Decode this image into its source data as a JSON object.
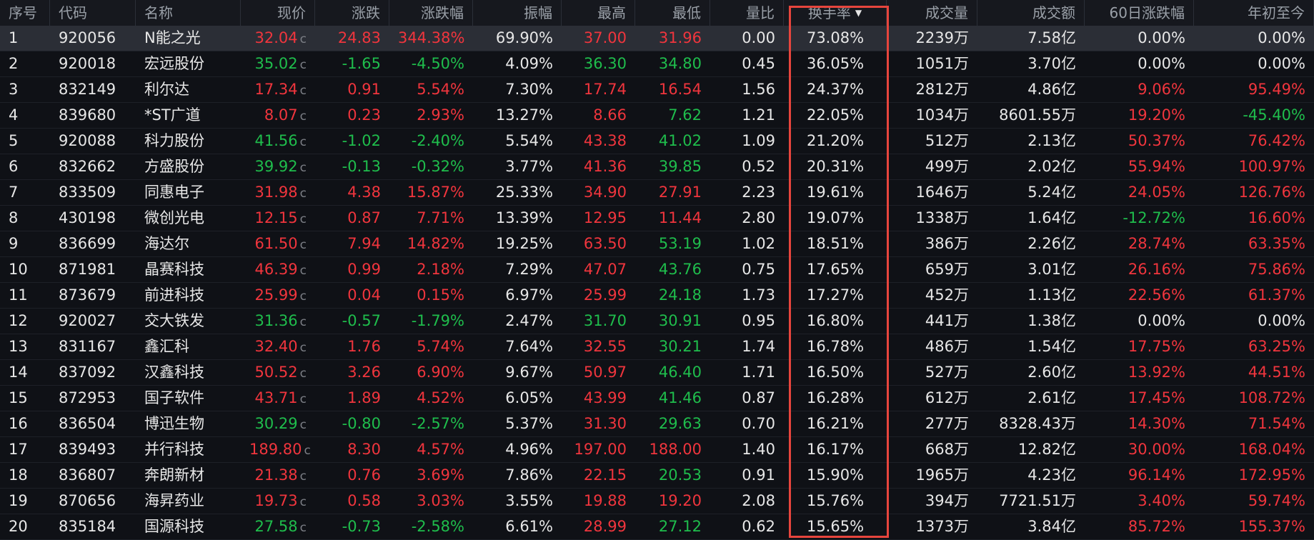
{
  "columns": [
    {
      "key": "idx",
      "label": "序号",
      "width": 70,
      "align": "left"
    },
    {
      "key": "code",
      "label": "代码",
      "width": 120,
      "align": "left"
    },
    {
      "key": "name",
      "label": "名称",
      "width": 147,
      "align": "left"
    },
    {
      "key": "price",
      "label": "现价",
      "width": 104,
      "align": "right"
    },
    {
      "key": "change",
      "label": "涨跌",
      "width": 104,
      "align": "right"
    },
    {
      "key": "pct",
      "label": "涨跌幅",
      "width": 117,
      "align": "right"
    },
    {
      "key": "amplitude",
      "label": "振幅",
      "width": 124,
      "align": "right"
    },
    {
      "key": "high",
      "label": "最高",
      "width": 103,
      "align": "right"
    },
    {
      "key": "low",
      "label": "最低",
      "width": 105,
      "align": "right"
    },
    {
      "key": "volratio",
      "label": "量比",
      "width": 103,
      "align": "right"
    },
    {
      "key": "turnover",
      "label": "换手率",
      "width": 144,
      "align": "center",
      "sorted": true
    },
    {
      "key": "volume",
      "label": "成交量",
      "width": 127,
      "align": "right"
    },
    {
      "key": "amount",
      "label": "成交额",
      "width": 150,
      "align": "right"
    },
    {
      "key": "d60",
      "label": "60日涨跌幅",
      "width": 153,
      "align": "right"
    },
    {
      "key": "ytd",
      "label": "年初至今",
      "width": 168,
      "align": "right"
    }
  ],
  "sort_arrow": "▼",
  "price_suffix": "c",
  "colors": {
    "up": "#f0353d",
    "down": "#1fbd4c",
    "flat": "#e7e7e7",
    "highlight": "#e7453d"
  },
  "rows": [
    {
      "idx": "1",
      "code": "920056",
      "name": "N能之光",
      "price": "32.04",
      "change": "24.83",
      "pct": "344.38%",
      "amplitude": "69.90%",
      "high": "37.00",
      "low": "31.96",
      "volratio": "0.00",
      "turnover": "73.08%",
      "volume": "2239万",
      "amount": "7.58亿",
      "d60": "0.00%",
      "ytd": "0.00%",
      "dir": "up",
      "highDir": "up",
      "lowDir": "up",
      "d60Dir": "flat",
      "ytdDir": "flat"
    },
    {
      "idx": "2",
      "code": "920018",
      "name": "宏远股份",
      "price": "35.02",
      "change": "-1.65",
      "pct": "-4.50%",
      "amplitude": "4.09%",
      "high": "36.30",
      "low": "34.80",
      "volratio": "0.45",
      "turnover": "36.05%",
      "volume": "1051万",
      "amount": "3.70亿",
      "d60": "0.00%",
      "ytd": "0.00%",
      "dir": "down",
      "highDir": "down",
      "lowDir": "down",
      "d60Dir": "flat",
      "ytdDir": "flat"
    },
    {
      "idx": "3",
      "code": "832149",
      "name": "利尔达",
      "price": "17.34",
      "change": "0.91",
      "pct": "5.54%",
      "amplitude": "7.30%",
      "high": "17.74",
      "low": "16.54",
      "volratio": "1.56",
      "turnover": "24.37%",
      "volume": "2812万",
      "amount": "4.86亿",
      "d60": "9.06%",
      "ytd": "95.49%",
      "dir": "up",
      "highDir": "up",
      "lowDir": "up",
      "d60Dir": "up",
      "ytdDir": "up"
    },
    {
      "idx": "4",
      "code": "839680",
      "name": "*ST广道",
      "price": "8.07",
      "change": "0.23",
      "pct": "2.93%",
      "amplitude": "13.27%",
      "high": "8.66",
      "low": "7.62",
      "volratio": "1.21",
      "turnover": "22.05%",
      "volume": "1034万",
      "amount": "8601.55万",
      "d60": "19.20%",
      "ytd": "-45.40%",
      "dir": "up",
      "highDir": "up",
      "lowDir": "down",
      "d60Dir": "up",
      "ytdDir": "down"
    },
    {
      "idx": "5",
      "code": "920088",
      "name": "科力股份",
      "price": "41.56",
      "change": "-1.02",
      "pct": "-2.40%",
      "amplitude": "5.54%",
      "high": "43.38",
      "low": "41.02",
      "volratio": "1.09",
      "turnover": "21.20%",
      "volume": "512万",
      "amount": "2.13亿",
      "d60": "50.37%",
      "ytd": "76.42%",
      "dir": "down",
      "highDir": "up",
      "lowDir": "down",
      "d60Dir": "up",
      "ytdDir": "up"
    },
    {
      "idx": "6",
      "code": "832662",
      "name": "方盛股份",
      "price": "39.92",
      "change": "-0.13",
      "pct": "-0.32%",
      "amplitude": "3.77%",
      "high": "41.36",
      "low": "39.85",
      "volratio": "0.52",
      "turnover": "20.31%",
      "volume": "499万",
      "amount": "2.02亿",
      "d60": "55.94%",
      "ytd": "100.97%",
      "dir": "down",
      "highDir": "up",
      "lowDir": "down",
      "d60Dir": "up",
      "ytdDir": "up"
    },
    {
      "idx": "7",
      "code": "833509",
      "name": "同惠电子",
      "price": "31.98",
      "change": "4.38",
      "pct": "15.87%",
      "amplitude": "25.33%",
      "high": "34.90",
      "low": "27.91",
      "volratio": "2.23",
      "turnover": "19.61%",
      "volume": "1646万",
      "amount": "5.24亿",
      "d60": "24.05%",
      "ytd": "126.76%",
      "dir": "up",
      "highDir": "up",
      "lowDir": "up",
      "d60Dir": "up",
      "ytdDir": "up"
    },
    {
      "idx": "8",
      "code": "430198",
      "name": "微创光电",
      "price": "12.15",
      "change": "0.87",
      "pct": "7.71%",
      "amplitude": "13.39%",
      "high": "12.95",
      "low": "11.44",
      "volratio": "2.80",
      "turnover": "19.07%",
      "volume": "1338万",
      "amount": "1.64亿",
      "d60": "-12.72%",
      "ytd": "16.60%",
      "dir": "up",
      "highDir": "up",
      "lowDir": "up",
      "d60Dir": "down",
      "ytdDir": "up"
    },
    {
      "idx": "9",
      "code": "836699",
      "name": "海达尔",
      "price": "61.50",
      "change": "7.94",
      "pct": "14.82%",
      "amplitude": "19.25%",
      "high": "63.50",
      "low": "53.19",
      "volratio": "1.02",
      "turnover": "18.51%",
      "volume": "386万",
      "amount": "2.26亿",
      "d60": "28.74%",
      "ytd": "63.35%",
      "dir": "up",
      "highDir": "up",
      "lowDir": "down",
      "d60Dir": "up",
      "ytdDir": "up"
    },
    {
      "idx": "10",
      "code": "871981",
      "name": "晶赛科技",
      "price": "46.39",
      "change": "0.99",
      "pct": "2.18%",
      "amplitude": "7.29%",
      "high": "47.07",
      "low": "43.76",
      "volratio": "0.75",
      "turnover": "17.65%",
      "volume": "659万",
      "amount": "3.01亿",
      "d60": "26.16%",
      "ytd": "75.86%",
      "dir": "up",
      "highDir": "up",
      "lowDir": "down",
      "d60Dir": "up",
      "ytdDir": "up"
    },
    {
      "idx": "11",
      "code": "873679",
      "name": "前进科技",
      "price": "25.99",
      "change": "0.04",
      "pct": "0.15%",
      "amplitude": "6.97%",
      "high": "25.99",
      "low": "24.18",
      "volratio": "1.73",
      "turnover": "17.27%",
      "volume": "452万",
      "amount": "1.13亿",
      "d60": "22.56%",
      "ytd": "61.37%",
      "dir": "up",
      "highDir": "up",
      "lowDir": "down",
      "d60Dir": "up",
      "ytdDir": "up"
    },
    {
      "idx": "12",
      "code": "920027",
      "name": "交大铁发",
      "price": "31.36",
      "change": "-0.57",
      "pct": "-1.79%",
      "amplitude": "2.47%",
      "high": "31.70",
      "low": "30.91",
      "volratio": "0.95",
      "turnover": "16.80%",
      "volume": "441万",
      "amount": "1.38亿",
      "d60": "0.00%",
      "ytd": "0.00%",
      "dir": "down",
      "highDir": "down",
      "lowDir": "down",
      "d60Dir": "flat",
      "ytdDir": "flat"
    },
    {
      "idx": "13",
      "code": "831167",
      "name": "鑫汇科",
      "price": "32.40",
      "change": "1.76",
      "pct": "5.74%",
      "amplitude": "7.64%",
      "high": "32.55",
      "low": "30.21",
      "volratio": "1.74",
      "turnover": "16.78%",
      "volume": "486万",
      "amount": "1.54亿",
      "d60": "17.75%",
      "ytd": "63.25%",
      "dir": "up",
      "highDir": "up",
      "lowDir": "down",
      "d60Dir": "up",
      "ytdDir": "up"
    },
    {
      "idx": "14",
      "code": "837092",
      "name": "汉鑫科技",
      "price": "50.52",
      "change": "3.26",
      "pct": "6.90%",
      "amplitude": "9.67%",
      "high": "50.97",
      "low": "46.40",
      "volratio": "1.71",
      "turnover": "16.50%",
      "volume": "527万",
      "amount": "2.60亿",
      "d60": "13.92%",
      "ytd": "44.51%",
      "dir": "up",
      "highDir": "up",
      "lowDir": "down",
      "d60Dir": "up",
      "ytdDir": "up"
    },
    {
      "idx": "15",
      "code": "872953",
      "name": "国子软件",
      "price": "43.71",
      "change": "1.89",
      "pct": "4.52%",
      "amplitude": "6.05%",
      "high": "43.99",
      "low": "41.46",
      "volratio": "0.87",
      "turnover": "16.28%",
      "volume": "612万",
      "amount": "2.61亿",
      "d60": "17.45%",
      "ytd": "108.72%",
      "dir": "up",
      "highDir": "up",
      "lowDir": "down",
      "d60Dir": "up",
      "ytdDir": "up"
    },
    {
      "idx": "16",
      "code": "836504",
      "name": "博迅生物",
      "price": "30.29",
      "change": "-0.80",
      "pct": "-2.57%",
      "amplitude": "5.37%",
      "high": "31.30",
      "low": "29.63",
      "volratio": "0.70",
      "turnover": "16.21%",
      "volume": "277万",
      "amount": "8328.43万",
      "d60": "14.30%",
      "ytd": "71.54%",
      "dir": "down",
      "highDir": "up",
      "lowDir": "down",
      "d60Dir": "up",
      "ytdDir": "up"
    },
    {
      "idx": "17",
      "code": "839493",
      "name": "并行科技",
      "price": "189.80",
      "change": "8.30",
      "pct": "4.57%",
      "amplitude": "4.96%",
      "high": "197.00",
      "low": "188.00",
      "volratio": "1.40",
      "turnover": "16.17%",
      "volume": "668万",
      "amount": "12.82亿",
      "d60": "30.00%",
      "ytd": "168.04%",
      "dir": "up",
      "highDir": "up",
      "lowDir": "up",
      "d60Dir": "up",
      "ytdDir": "up"
    },
    {
      "idx": "18",
      "code": "836807",
      "name": "奔朗新材",
      "price": "21.38",
      "change": "0.76",
      "pct": "3.69%",
      "amplitude": "7.86%",
      "high": "22.15",
      "low": "20.53",
      "volratio": "0.91",
      "turnover": "15.90%",
      "volume": "1965万",
      "amount": "4.23亿",
      "d60": "96.14%",
      "ytd": "172.95%",
      "dir": "up",
      "highDir": "up",
      "lowDir": "down",
      "d60Dir": "up",
      "ytdDir": "up"
    },
    {
      "idx": "19",
      "code": "870656",
      "name": "海昇药业",
      "price": "19.73",
      "change": "0.58",
      "pct": "3.03%",
      "amplitude": "3.55%",
      "high": "19.88",
      "low": "19.20",
      "volratio": "2.08",
      "turnover": "15.76%",
      "volume": "394万",
      "amount": "7721.51万",
      "d60": "3.40%",
      "ytd": "59.74%",
      "dir": "up",
      "highDir": "up",
      "lowDir": "up",
      "d60Dir": "up",
      "ytdDir": "up"
    },
    {
      "idx": "20",
      "code": "835184",
      "name": "国源科技",
      "price": "27.58",
      "change": "-0.73",
      "pct": "-2.58%",
      "amplitude": "6.61%",
      "high": "28.99",
      "low": "27.12",
      "volratio": "0.62",
      "turnover": "15.65%",
      "volume": "1373万",
      "amount": "3.84亿",
      "d60": "85.72%",
      "ytd": "155.37%",
      "dir": "down",
      "highDir": "up",
      "lowDir": "down",
      "d60Dir": "up",
      "ytdDir": "up"
    }
  ]
}
